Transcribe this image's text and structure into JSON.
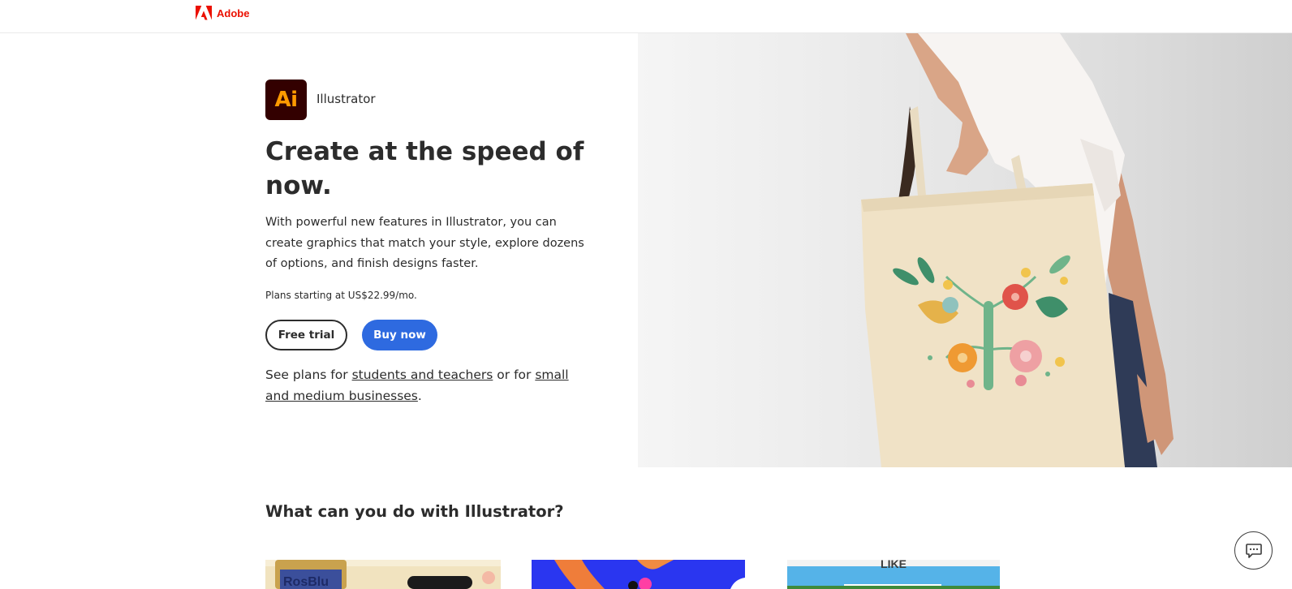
{
  "nav": {
    "brand": "Adobe",
    "brand_color": "#eb1000"
  },
  "hero": {
    "app_tile_text": "Ai",
    "app_name": "Illustrator",
    "headline": "Create at the speed of now.",
    "body": "With powerful new features in Illustrator, you can create graphics that match your style, explore dozens of options, and finish designs faster.",
    "price_text": "Plans starting at US$22.99/mo.",
    "free_trial_label": "Free trial",
    "buy_now_label": "Buy now",
    "see_plans_prefix": "See plans for ",
    "students_link": "students and teachers",
    "see_plans_middle": " or for ",
    "business_link": "small and medium businesses",
    "see_plans_suffix": ".",
    "accent_color": "#2e6ae0",
    "image_alt": "tote-bag-with-flower-illustration"
  },
  "section": {
    "title": "What can you do with Illustrator?",
    "cards": [
      {
        "name": "jar-artwork-card",
        "partial_text": "RosBlu"
      },
      {
        "name": "abstract-illustration-card"
      },
      {
        "name": "like-lettering-card",
        "partial_text": "LIKE"
      }
    ]
  },
  "chat": {
    "icon": "chat-bubble-icon"
  }
}
